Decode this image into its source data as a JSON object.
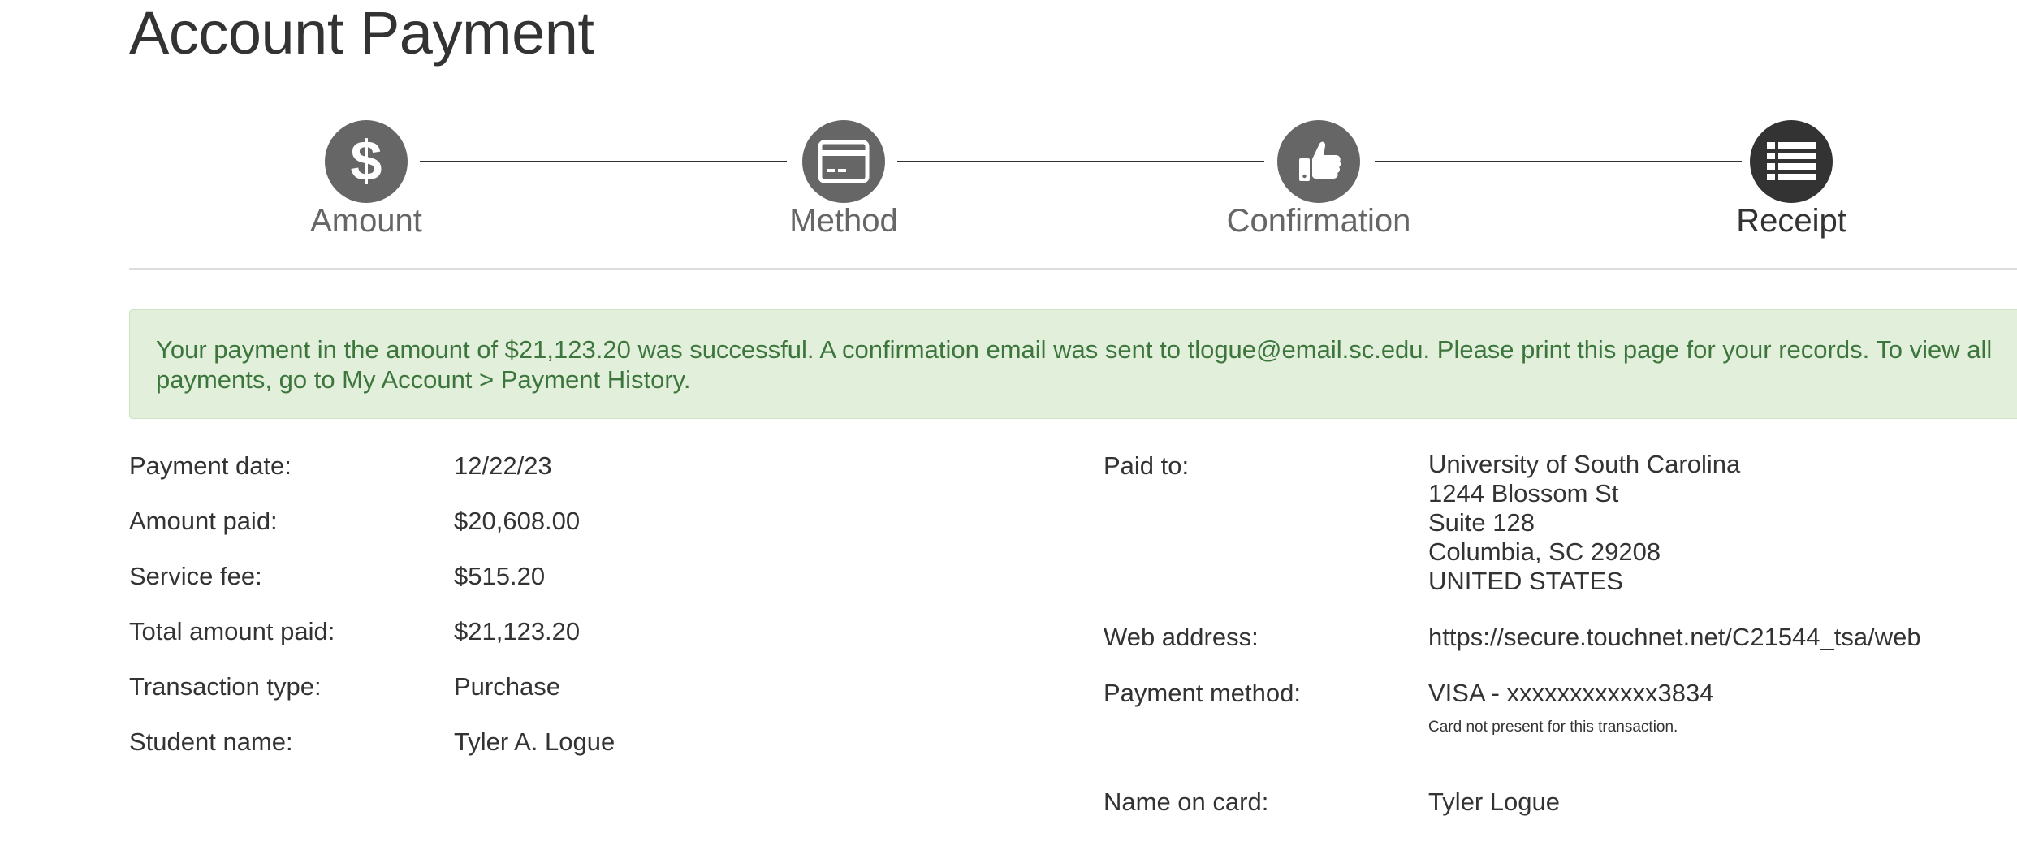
{
  "page": {
    "title": "Account Payment"
  },
  "steps": [
    {
      "label": "Amount",
      "icon": "dollar-icon",
      "active": false
    },
    {
      "label": "Method",
      "icon": "credit-card-icon",
      "active": false
    },
    {
      "label": "Confirmation",
      "icon": "thumbs-up-icon",
      "active": false
    },
    {
      "label": "Receipt",
      "icon": "list-icon",
      "active": true
    }
  ],
  "alert": {
    "message": "Your payment in the amount of $21,123.20 was successful.  A confirmation email was sent to tlogue@email.sc.edu.  Please print this page for your records. To view all payments, go to My Account > Payment History."
  },
  "details_left": [
    {
      "label": "Payment date:",
      "value": "12/22/23"
    },
    {
      "label": "Amount paid:",
      "value": "$20,608.00"
    },
    {
      "label": "Service fee:",
      "value": "$515.20"
    },
    {
      "label": "Total amount paid:",
      "value": "$21,123.20"
    },
    {
      "label": "Transaction type:",
      "value": "Purchase"
    },
    {
      "label": "Student name:",
      "value": "Tyler A. Logue"
    }
  ],
  "details_right": {
    "paid_to": {
      "label": "Paid to:",
      "lines": [
        "University of South Carolina",
        "1244 Blossom St",
        "Suite 128",
        "Columbia,  SC  29208",
        "UNITED STATES"
      ]
    },
    "web_address": {
      "label": "Web address:",
      "value": "https://secure.touchnet.net/C21544_tsa/web"
    },
    "payment_method": {
      "label": "Payment method:",
      "value": "VISA - xxxxxxxxxxxx3834",
      "note": "Card not present for this transaction."
    },
    "name_on_card": {
      "label": "Name on card:",
      "value": "Tyler Logue"
    }
  },
  "colors": {
    "step_inactive": "#666666",
    "step_active": "#333333",
    "alert_bg": "#e2efdb",
    "alert_text": "#3c763d"
  }
}
